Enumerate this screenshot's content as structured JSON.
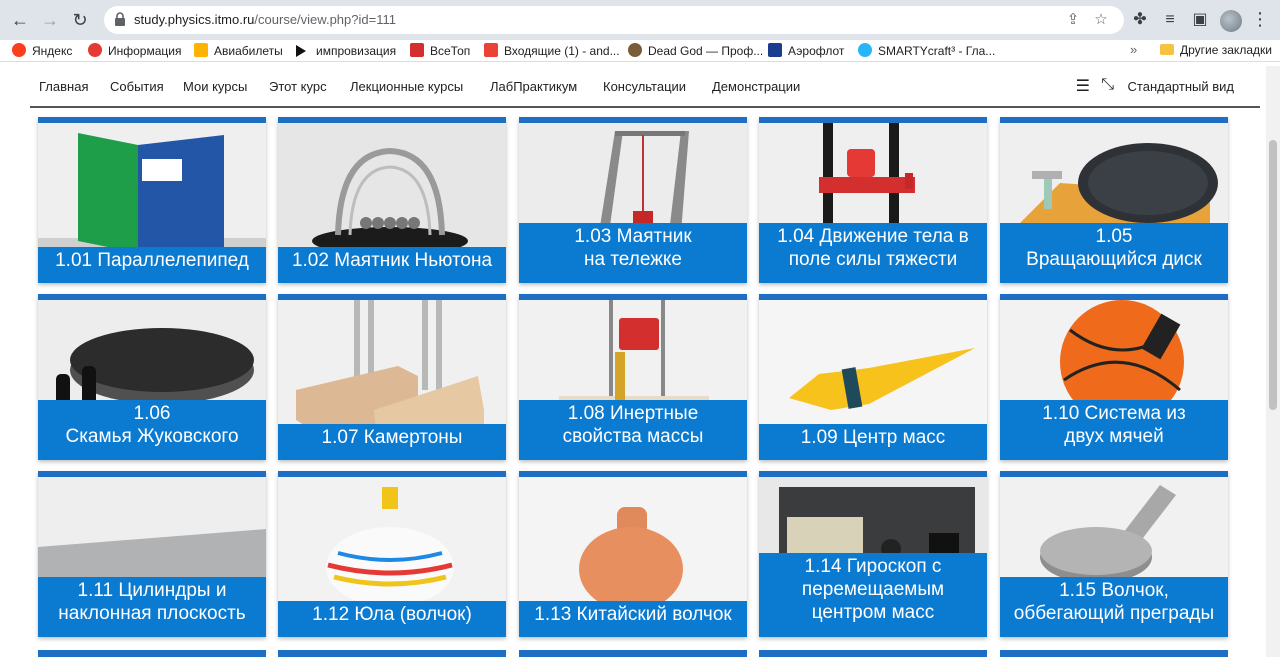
{
  "browser": {
    "url_host": "study.physics.itmo.ru",
    "url_path": "/course/view.php?id=111",
    "bookmarks": [
      {
        "label": "Яндекс",
        "color": "#fc3f1d"
      },
      {
        "label": "Информация",
        "color": "#e53935"
      },
      {
        "label": "Авиабилеты",
        "color": "#ffb300"
      },
      {
        "label": "импровизация",
        "color": "#111111"
      },
      {
        "label": "ВсеТоп",
        "color": "#d32f2f"
      },
      {
        "label": "Входящие (1) - and...",
        "color": "#ea4335"
      },
      {
        "label": "Dead God — Проф...",
        "color": "#7a5c3a"
      },
      {
        "label": "Аэрофлот",
        "color": "#1a3d8f"
      },
      {
        "label": "SMARTYcraft³ - Гла...",
        "color": "#29b6f6"
      }
    ],
    "more_bookmarks": "»",
    "other_bookmarks": "Другие закладки"
  },
  "site_nav": {
    "items": [
      "Главная",
      "События",
      "Мои курсы",
      "Этот курс",
      "Лекционные курсы",
      "ЛабПрактикум",
      "Консультации",
      "Демонстрации"
    ],
    "standard_view": "Стандартный вид"
  },
  "accent_color": "#0b7ad1",
  "cards": [
    {
      "lines": [
        "1.01 Параллелепипед"
      ]
    },
    {
      "lines": [
        "1.02 Маятник Ньютона"
      ]
    },
    {
      "lines": [
        "1.03 Маятник",
        "на тележке"
      ]
    },
    {
      "lines": [
        "1.04 Движение тела в",
        "поле силы тяжести"
      ]
    },
    {
      "lines": [
        "1.05",
        "Вращающийся диск"
      ]
    },
    {
      "lines": [
        "1.06",
        "Скамья Жуковского"
      ]
    },
    {
      "lines": [
        "1.07 Камертоны"
      ]
    },
    {
      "lines": [
        "1.08 Инертные",
        "свойства массы"
      ]
    },
    {
      "lines": [
        "1.09 Центр масс"
      ]
    },
    {
      "lines": [
        "1.10 Система из",
        "двух мячей"
      ]
    },
    {
      "lines": [
        "1.11 Цилиндры и",
        "наклонная плоскость"
      ]
    },
    {
      "lines": [
        "1.12 Юла (волчок)"
      ]
    },
    {
      "lines": [
        "1.13 Китайский волчок"
      ]
    },
    {
      "lines": [
        "1.14 Гироскоп с",
        "перемещаемым",
        "центром масс"
      ]
    },
    {
      "lines": [
        "1.15 Волчок,",
        "оббегающий преграды"
      ]
    }
  ]
}
